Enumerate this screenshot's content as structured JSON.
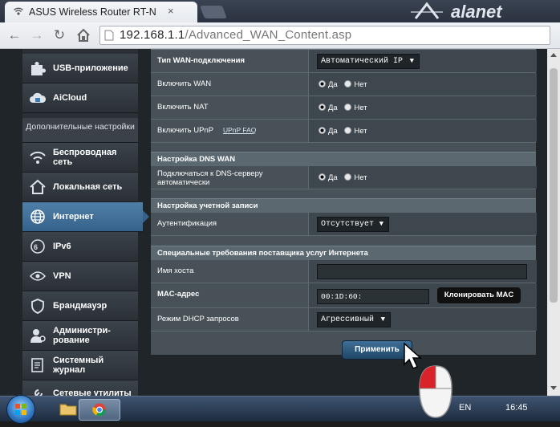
{
  "browser": {
    "tab_title": "ASUS Wireless Router RT-N",
    "tab_close": "×",
    "address_host": "192.168.1.1",
    "address_path": "/Advanced_WAN_Content.asp"
  },
  "sidebar": {
    "items_top": [
      {
        "label": "USB-приложение",
        "icon": "puzzle-icon"
      },
      {
        "label": "AiCloud",
        "icon": "cloud-icon"
      }
    ],
    "section_header": "Дополнительные настройки",
    "items": [
      {
        "label": "Беспроводная сеть",
        "icon": "wifi-icon"
      },
      {
        "label": "Локальная сеть",
        "icon": "home-icon"
      },
      {
        "label": "Интернет",
        "icon": "globe-icon",
        "active": true
      },
      {
        "label": "IPv6",
        "icon": "ipv6-icon"
      },
      {
        "label": "VPN",
        "icon": "vpn-icon"
      },
      {
        "label": "Брандмауэр",
        "icon": "shield-icon"
      },
      {
        "label": "Администри-рование",
        "icon": "admin-icon"
      },
      {
        "label": "Системный журнал",
        "icon": "log-icon"
      },
      {
        "label": "Сетевые утилиты",
        "icon": "tools-icon"
      }
    ]
  },
  "form": {
    "wan_type_label": "Тип WAN-подключения",
    "wan_type_value": "Автоматический IP",
    "enable_wan_label": "Включить WAN",
    "enable_nat_label": "Включить NAT",
    "enable_upnp_label": "Включить UPnP",
    "upnp_faq": "UPnP FAQ",
    "yes": "Да",
    "no": "Нет",
    "dns_header": "Настройка DNS WAN",
    "dns_auto_label": "Подключаться к DNS-серверу автоматически",
    "account_header": "Настройка учетной записи",
    "auth_label": "Аутентификация",
    "auth_value": "Отсутствует",
    "isp_header": "Специальные требования поставщика услуг Интернета",
    "hostname_label": "Имя хоста",
    "hostname_value": "",
    "mac_label": "MAC-адрес",
    "mac_value": "00:1D:60:",
    "clone_mac": "Клонировать MAC",
    "dhcp_label": "Режим DHCP запросов",
    "dhcp_value": "Агрессивный",
    "apply": "Применить"
  },
  "taskbar": {
    "lang": "EN",
    "clock": "16:45"
  },
  "colors": {
    "active_menu": "#36628a",
    "content_bg": "#475157",
    "group_header": "#5b6870"
  }
}
